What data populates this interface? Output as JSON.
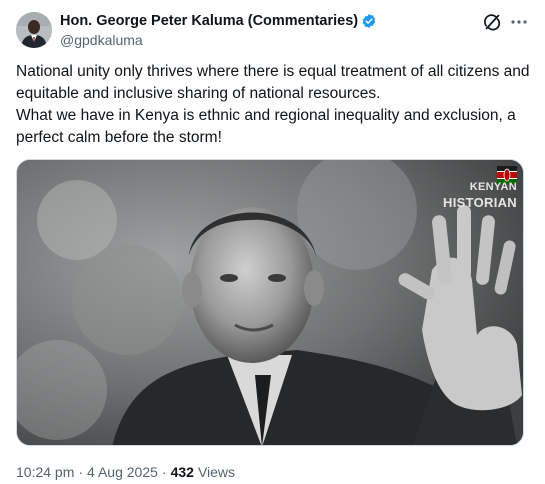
{
  "author": {
    "display_name": "Hon. George Peter Kaluma (Commentaries)",
    "handle": "@gpdkaluma",
    "verified_color": "#1d9bf0"
  },
  "tweet": {
    "paragraphs": [
      "National unity only thrives where there is equal treatment of all citizens and equitable and inclusive sharing of national resources.",
      "What we have in Kenya is ethnic and regional inequality and exclusion, a perfect calm before the storm!"
    ]
  },
  "media": {
    "watermark_line1": "KENYAN",
    "watermark_line2": "HISTORIAN"
  },
  "meta": {
    "time": "10:24 pm",
    "separator": "·",
    "date": "4 Aug 2025",
    "views_count": "432",
    "views_label": "Views"
  },
  "icons": {
    "grok": "grok-icon",
    "more": "more-icon",
    "verified": "verified-badge-icon"
  }
}
